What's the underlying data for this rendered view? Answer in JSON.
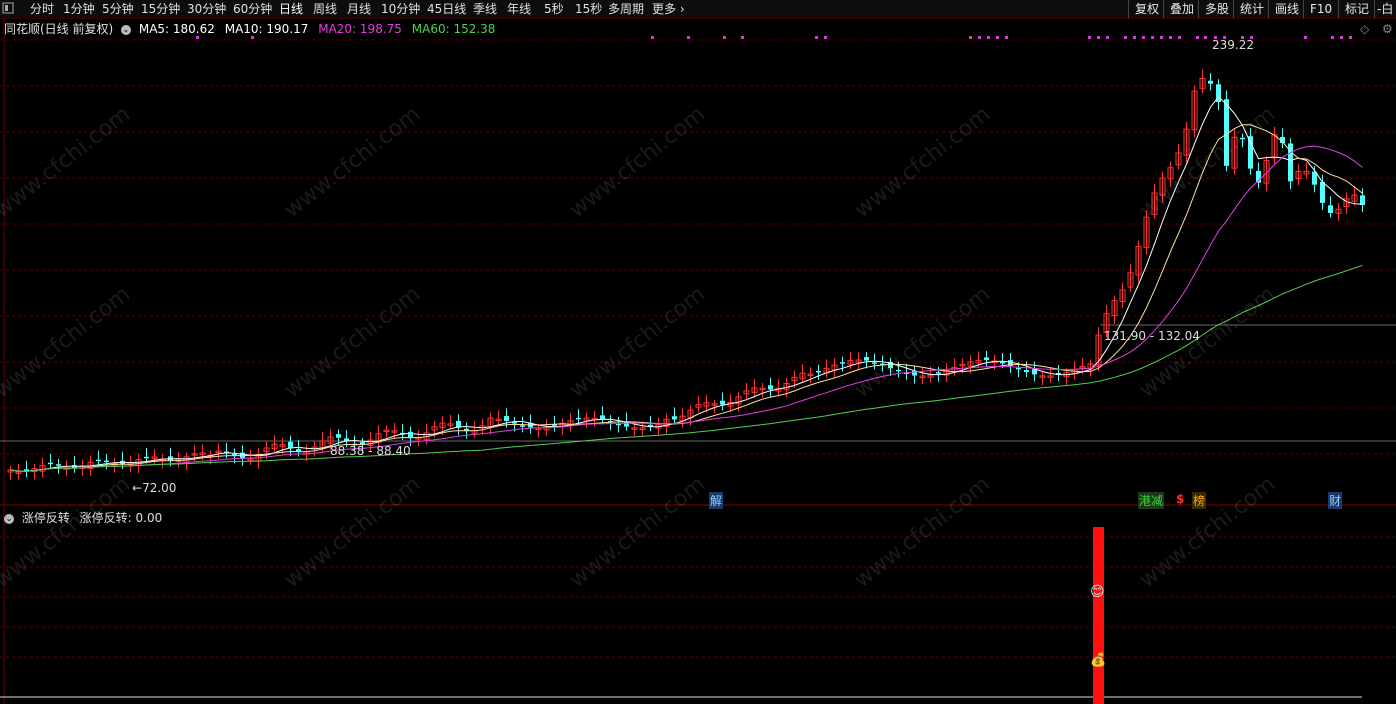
{
  "toolbar": {
    "left_tabs": [
      "分时",
      "1分钟",
      "5分钟",
      "15分钟",
      "30分钟",
      "60分钟",
      "日线",
      "周线",
      "月线",
      "10分钟",
      "45日线",
      "季线",
      "年线",
      "5秒",
      "15秒",
      "多周期",
      "更多"
    ],
    "selected_tab": "日线",
    "right_buttons": [
      "复权",
      "叠加",
      "多股",
      "统计",
      "画线",
      "F10",
      "标记",
      "-白"
    ]
  },
  "main_chart": {
    "stock_title": "同花顺(日线 前复权)",
    "ma": [
      {
        "label": "MA5: 180.62",
        "color": "#ffffff"
      },
      {
        "label": "MA10: 190.17",
        "color": "#ffffff"
      },
      {
        "label": "MA20: 198.75",
        "color": "#e040e0"
      },
      {
        "label": "MA60: 152.38",
        "color": "#50d050"
      }
    ],
    "annotations": {
      "high": "239.22",
      "low": "72.00",
      "range1": "88.38 - 88.40",
      "range2": "131.90 - 132.04"
    },
    "event_tags": [
      {
        "text": "解",
        "color": "#66ccff"
      },
      {
        "text": "港减",
        "color": "#40d040"
      },
      {
        "text": "$",
        "color": "#ff3030"
      },
      {
        "text": "榜",
        "color": "#ff9900"
      },
      {
        "text": "财",
        "color": "#66ccff"
      }
    ]
  },
  "sub_chart": {
    "indicator_name": "涨停反转",
    "value_label": "涨停反转: 0.00"
  },
  "watermark": "www.cfchi.com",
  "colors": {
    "up": "#ff3333",
    "down": "#54ffff",
    "grid": "#5a0000",
    "ma5": "#ffffff",
    "ma10": "#ffe0a0",
    "ma20": "#e040e0",
    "ma60": "#50d050"
  }
}
